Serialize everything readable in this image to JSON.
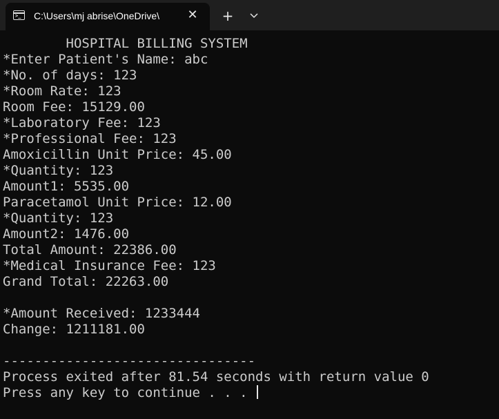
{
  "window": {
    "tab_title": "C:\\Users\\mj abrise\\OneDrive\\",
    "tab_icon": "console-icon",
    "close_symbol": "✕",
    "new_tab_symbol": "+"
  },
  "console": {
    "lines": [
      "        HOSPITAL BILLING SYSTEM",
      "*Enter Patient's Name: abc",
      "*No. of days: 123",
      "*Room Rate: 123",
      "Room Fee: 15129.00",
      "*Laboratory Fee: 123",
      "*Professional Fee: 123",
      "Amoxicillin Unit Price: 45.00",
      "*Quantity: 123",
      "Amount1: 5535.00",
      "Paracetamol Unit Price: 12.00",
      "*Quantity: 123",
      "Amount2: 1476.00",
      "Total Amount: 22386.00",
      "*Medical Insurance Fee: 123",
      "Grand Total: 22263.00",
      "",
      "*Amount Received: 1233444",
      "Change: 1211181.00",
      "",
      "--------------------------------",
      "Process exited after 81.54 seconds with return value 0",
      "Press any key to continue . . . "
    ]
  }
}
